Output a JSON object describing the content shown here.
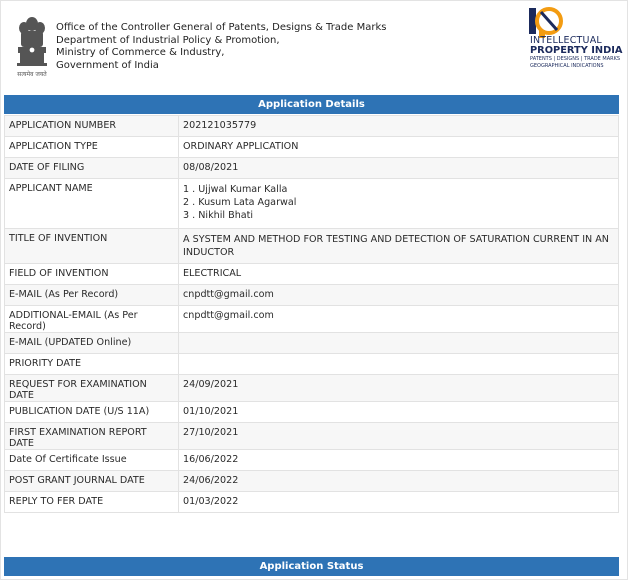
{
  "header": {
    "office_lines": [
      "Office of the Controller General of Patents, Designs & Trade Marks",
      "Department of Industrial Policy & Promotion,",
      "Ministry of Commerce & Industry,",
      "Government of India"
    ],
    "emblem_motto": "सत्यमेव जयते",
    "ip_logo": {
      "line1": "INTELLECTUAL",
      "line2a": "PROPERTY ",
      "line2b": "INDIA",
      "line3": "PATENTS | DESIGNS | TRADE MARKS",
      "line4": "GEOGRAPHICAL INDICATIONS"
    }
  },
  "sections": {
    "details_title": "Application Details",
    "status_title": "Application Status"
  },
  "details": [
    {
      "label": "APPLICATION NUMBER",
      "value": "202121035779"
    },
    {
      "label": "APPLICATION TYPE",
      "value": "ORDINARY APPLICATION"
    },
    {
      "label": "DATE OF FILING",
      "value": "08/08/2021"
    },
    {
      "label": "APPLICANT NAME",
      "values": [
        "1 . Ujjwal Kumar Kalla",
        "2 . Kusum Lata Agarwal",
        "3 . Nikhil Bhati"
      ]
    },
    {
      "label": "TITLE OF INVENTION",
      "value": "A SYSTEM AND METHOD FOR TESTING AND DETECTION OF SATURATION CURRENT IN AN INDUCTOR"
    },
    {
      "label": "FIELD OF INVENTION",
      "value": "ELECTRICAL"
    },
    {
      "label": "E-MAIL (As Per Record)",
      "value": "cnpdtt@gmail.com"
    },
    {
      "label": "ADDITIONAL-EMAIL (As Per Record)",
      "value": "cnpdtt@gmail.com"
    },
    {
      "label": "E-MAIL (UPDATED Online)",
      "value": ""
    },
    {
      "label": "PRIORITY DATE",
      "value": ""
    },
    {
      "label": "REQUEST FOR EXAMINATION DATE",
      "value": "24/09/2021"
    },
    {
      "label": "PUBLICATION DATE (U/S 11A)",
      "value": "01/10/2021"
    },
    {
      "label": "FIRST EXAMINATION REPORT DATE",
      "value": "27/10/2021"
    },
    {
      "label": "Date Of Certificate Issue",
      "value": "16/06/2022"
    },
    {
      "label": "POST GRANT JOURNAL DATE",
      "value": "24/06/2022"
    },
    {
      "label": "REPLY TO FER DATE",
      "value": "01/03/2022"
    }
  ],
  "colors": {
    "bar": "#2e73b5",
    "ip_orange": "#f39c12",
    "ip_navy": "#1b2a5c"
  }
}
